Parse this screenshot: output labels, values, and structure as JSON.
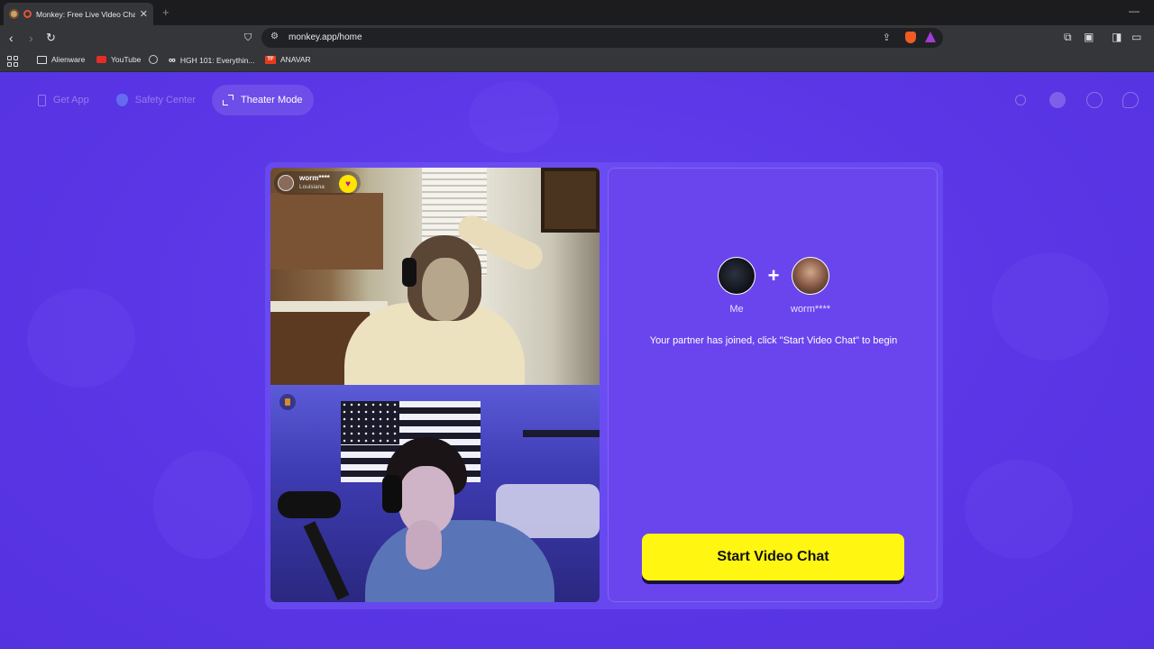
{
  "browser": {
    "tab_title": "Monkey: Free Live Video Chat",
    "url": "monkey.app/home",
    "bookmarks": [
      "Alienware",
      "YouTube",
      "HGH 101: Everythin...",
      "ANAVAR"
    ]
  },
  "nav": {
    "get_app": "Get App",
    "safety_center": "Safety Center",
    "theater_mode": "Theater Mode"
  },
  "video": {
    "partner_name": "worm****",
    "partner_location": "Louisiana"
  },
  "match": {
    "me_label": "Me",
    "partner_label": "worm****",
    "plus": "+",
    "status": "Your partner has joined, click \"Start Video Chat\" to begin"
  },
  "cta": {
    "start_label": "Start Video Chat"
  },
  "colors": {
    "page_bg": "#5a35e6",
    "cta_bg": "#fff612",
    "heart_badge": "#ffe500"
  }
}
